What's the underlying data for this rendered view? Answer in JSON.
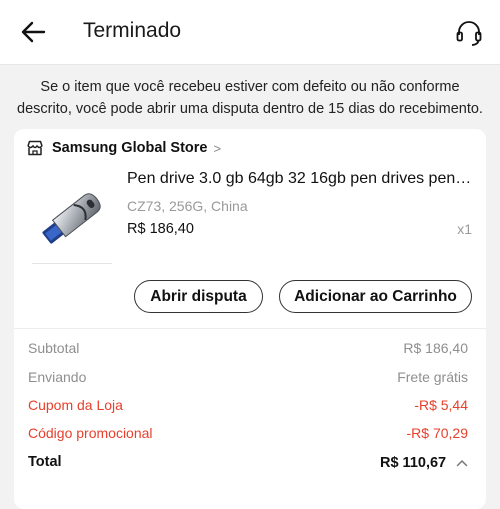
{
  "header": {
    "title": "Terminado",
    "back_icon": "arrow-left-icon",
    "support_icon": "headset-icon"
  },
  "notice": {
    "line1": "Se o item que você recebeu estiver com defeito ou não conforme",
    "line2": "descrito, você pode abrir uma disputa dentro de 15 dias do recebimento."
  },
  "store": {
    "icon": "store-icon",
    "name": "Samsung Global Store",
    "chevron": ">"
  },
  "product": {
    "title": "Pen drive 3.0 gb 64gb 32 16gb pen drives pendrive",
    "variant": "CZ73, 256G, China",
    "price": "R$ 186,40",
    "quantity": "x1"
  },
  "actions": {
    "dispute_label": "Abrir disputa",
    "cart_label": "Adicionar ao Carrinho"
  },
  "summary": {
    "subtotal_label": "Subtotal",
    "subtotal_value": "R$ 186,40",
    "shipping_label": "Enviando",
    "shipping_value": "Frete grátis",
    "store_coupon_label": "Cupom da Loja",
    "store_coupon_value": "-R$ 5,44",
    "promo_code_label": "Código promocional",
    "promo_code_value": "-R$ 70,29",
    "total_label": "Total",
    "total_value": "R$ 110,67"
  },
  "colors": {
    "discount_red": "#e8402c",
    "muted_gray": "#8f8f8f",
    "background": "#f2f2f2"
  }
}
